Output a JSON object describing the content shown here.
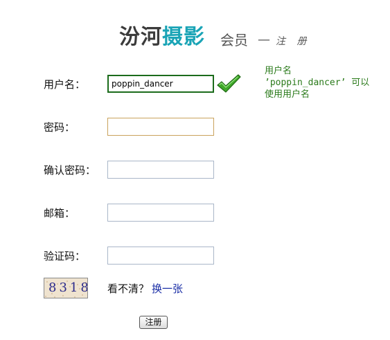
{
  "logo": {
    "brand_part1": "汾河",
    "brand_part2": "摄影",
    "subtitle": "会员",
    "dash": "—",
    "register": "注 册"
  },
  "form": {
    "username": {
      "label": "用户名：",
      "value": "poppin_dancer",
      "status": "valid"
    },
    "password": {
      "label": "密码：",
      "value": ""
    },
    "confirm_password": {
      "label": "确认密码：",
      "value": ""
    },
    "email": {
      "label": "邮箱：",
      "value": ""
    },
    "captcha": {
      "label": "验证码：",
      "value": "",
      "image_text": "8318",
      "cant_see_text": "看不清？",
      "refresh_link": "换一张"
    },
    "submit_label": "注册"
  },
  "validation_message": {
    "line1": "用户名",
    "line2": "’poppin_dancer’ 可以",
    "line3": "使用用户名"
  },
  "colors": {
    "brand_teal": "#1aa4b6",
    "valid_green": "#2a7a1a",
    "link_blue": "#1a2ea6"
  },
  "icons": {
    "check": "green-checkmark"
  }
}
